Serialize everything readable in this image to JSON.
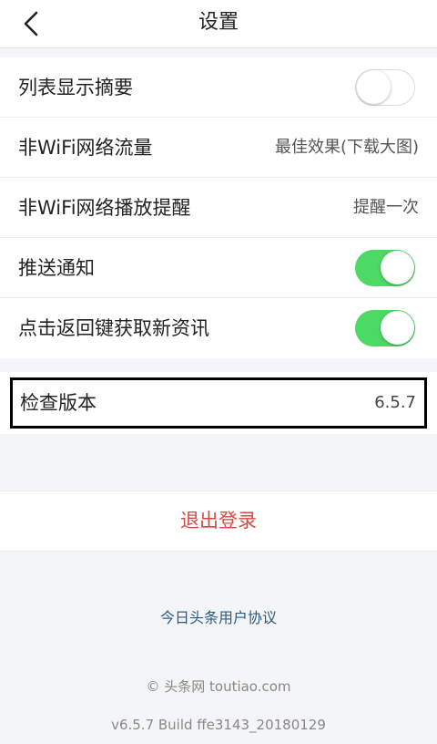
{
  "header": {
    "title": "设置",
    "back_icon": "chevron-left-icon"
  },
  "settings": {
    "rows": [
      {
        "label": "列表显示摘要",
        "type": "toggle",
        "state": "off"
      },
      {
        "label": "非WiFi网络流量",
        "type": "value",
        "value": "最佳效果(下载大图)"
      },
      {
        "label": "非WiFi网络播放提醒",
        "type": "value",
        "value": "提醒一次"
      },
      {
        "label": "推送通知",
        "type": "toggle",
        "state": "on"
      },
      {
        "label": "点击返回键获取新资讯",
        "type": "toggle",
        "state": "on"
      }
    ]
  },
  "version": {
    "label": "检查版本",
    "value": "6.5.7"
  },
  "logout": {
    "label": "退出登录"
  },
  "footer": {
    "agreement": "今日头条用户协议",
    "copyright": "© 头条网 toutiao.com",
    "build": "v6.5.7 Build ffe3143_20180129"
  },
  "colors": {
    "toggle_on": "#4cd964",
    "logout_text": "#d44a45",
    "link_text": "#2b5a82"
  }
}
